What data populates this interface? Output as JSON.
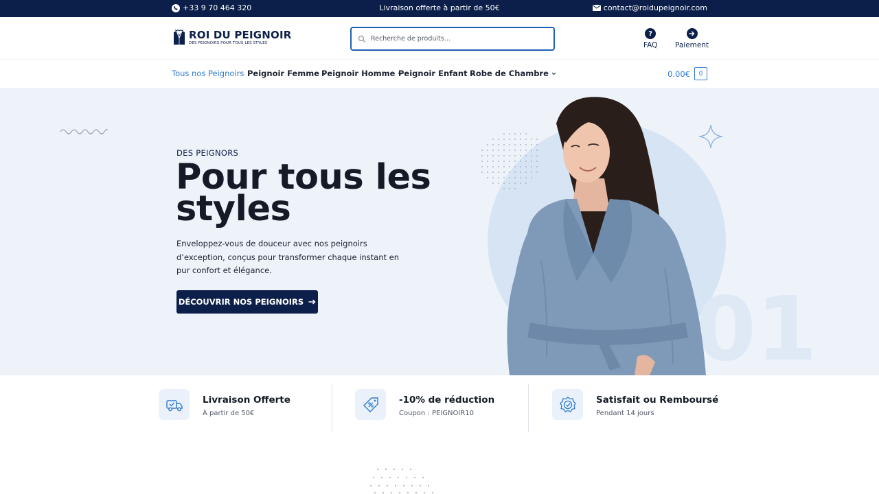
{
  "topbar": {
    "phone": "+33 9 70 464 320",
    "phone_icon": "phone-icon",
    "promo": "Livraison offerte à partir de 50€",
    "email": "contact@roidupeignoir.com",
    "email_icon": "mail-icon"
  },
  "header": {
    "logo": {
      "brand": "ROI DU PEIGNOIR",
      "tagline": "DES PEIGNOIRS POUR TOUS LES STYLES"
    },
    "search": {
      "placeholder": "Recherche de produits…",
      "icon": "search-icon"
    },
    "links": [
      {
        "label": "FAQ",
        "icon": "question-icon"
      },
      {
        "label": "Paiement",
        "icon": "arrow-right-circle-icon"
      }
    ]
  },
  "nav": {
    "items": [
      {
        "label": "Tous nos Peignoirs",
        "active": true
      },
      {
        "label": "Peignoir Femme"
      },
      {
        "label": "Peignoir Homme"
      },
      {
        "label": "Peignoir Enfant"
      },
      {
        "label": "Robe de Chambre"
      }
    ],
    "cart": {
      "total": "0.00€",
      "count": "0",
      "icon": "cart-icon"
    }
  },
  "hero": {
    "eyebrow": "DES PEIGNORS",
    "title_line1": "Pour tous les",
    "title_line2": "styles",
    "description": "Enveloppez-vous de douceur avec nos peignoirs d’exception, conçus pour transformer chaque instant en pur confort et élégance.",
    "cta": "DÉCOUVRIR NOS PEIGNOIRS",
    "cta_icon": "arrow-right-icon",
    "slide_number": "01"
  },
  "features": [
    {
      "title": "Livraison Offerte",
      "subtitle": "À partir de 50€",
      "icon": "truck-icon"
    },
    {
      "title": "-10% de réduction",
      "subtitle": "Coupon : PEIGNOIR10",
      "icon": "discount-tag-icon"
    },
    {
      "title": "Satisfait ou Remboursé",
      "subtitle": "Pendant 14 jours",
      "icon": "badge-check-icon"
    }
  ],
  "colors": {
    "navy": "#0b1f4a",
    "accent_blue": "#2f7bd0",
    "hero_bg": "#eef3fa",
    "circle": "#d6e4f4"
  }
}
